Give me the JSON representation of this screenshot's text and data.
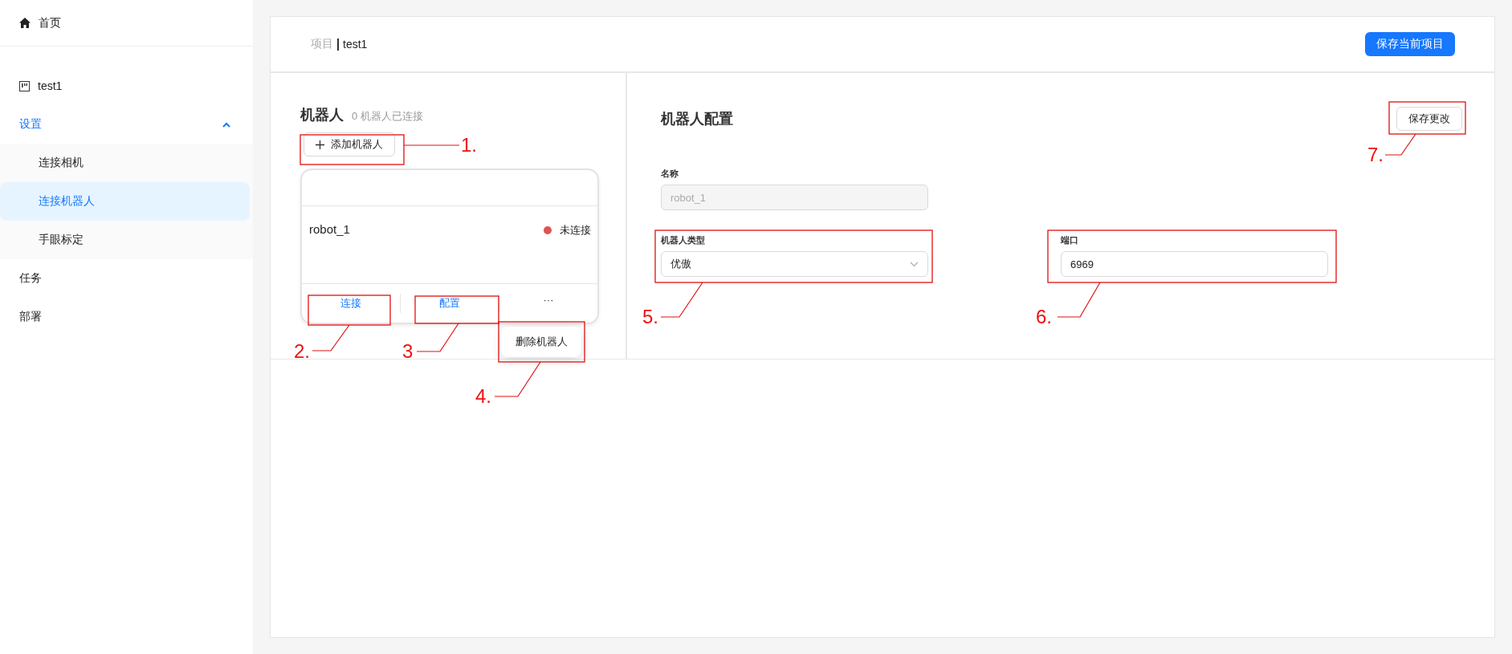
{
  "sidebar": {
    "home": {
      "label": "首页"
    },
    "items": [
      {
        "label": "test1",
        "kind": "project"
      },
      {
        "label": "设置",
        "kind": "group",
        "selected": true,
        "expanded": true,
        "children": [
          {
            "label": "连接相机",
            "selected": false
          },
          {
            "label": "连接机器人",
            "selected": true
          },
          {
            "label": "手眼标定",
            "selected": false
          }
        ]
      },
      {
        "label": "任务",
        "kind": "plain"
      },
      {
        "label": "部署",
        "kind": "plain"
      }
    ]
  },
  "header": {
    "breadcrumb": [
      "项目",
      "test1"
    ],
    "save_button": "保存当前项目"
  },
  "robots_panel": {
    "title": "机器人",
    "subtitle": "0 机器人已连接",
    "add_button": "添加机器人",
    "cards": [
      {
        "name": "robot_1",
        "status": "未连接",
        "color": "#e05252",
        "actions": [
          "连接",
          "配置"
        ],
        "more": "···",
        "menu": [
          "删除机器人"
        ]
      }
    ]
  },
  "config_panel": {
    "title": "机器人配置",
    "save_button": "保存更改",
    "fields": [
      {
        "label": "名称",
        "kind": "input",
        "value": "robot_1",
        "disabled": true
      },
      {
        "label": "机器人类型",
        "kind": "select",
        "value": "优傲"
      },
      {
        "label": "端口",
        "kind": "input",
        "value": "6969",
        "disabled": false
      }
    ]
  },
  "annotations": [
    {
      "label": "1."
    },
    {
      "label": "2."
    },
    {
      "label": "3"
    },
    {
      "label": "4."
    },
    {
      "label": "5."
    },
    {
      "label": "6."
    },
    {
      "label": "7."
    }
  ]
}
